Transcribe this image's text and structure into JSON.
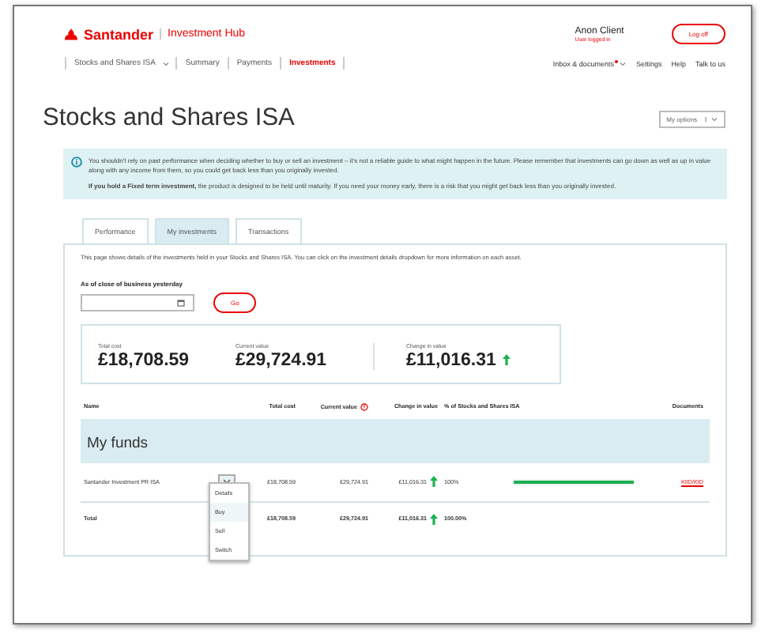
{
  "header": {
    "brand": "Santander",
    "product": "Investment Hub",
    "user": "Anon Client",
    "user_status": "User logged in",
    "logoff": "Log off"
  },
  "nav": {
    "items": [
      {
        "label": "Stocks and Shares ISA",
        "selected": false,
        "dropdown": true
      },
      {
        "label": "Summary",
        "selected": false
      },
      {
        "label": "Payments",
        "selected": false
      },
      {
        "label": "Investments",
        "selected": true
      }
    ],
    "links": [
      {
        "label": "Inbox & documents",
        "alert": true
      },
      {
        "label": "Settings",
        "alert": false
      },
      {
        "label": "Help",
        "alert": false
      },
      {
        "label": "Talk to us",
        "alert": false
      }
    ]
  },
  "title": "Stocks and Shares ISA",
  "options_button": "My options",
  "info": [
    "You shouldn't rely on past performance when deciding whether to buy or sell an investment – it's not a reliable guide to what might happen in the future. Please remember that investments can go down as well as up in value along with any income from them, so you could get back less than you originally invested.",
    "**If you hold a Fixed term investment,** the product is designed to be held until maturity. If you need your money early, there is a risk that you might get back less than you originally invested."
  ],
  "tabs": [
    {
      "label": "Performance",
      "selected": false
    },
    {
      "label": "My investments",
      "selected": true
    },
    {
      "label": "Transactions",
      "selected": false
    }
  ],
  "intro": "This page shows details of the investments held in your Stocks and Shares ISA. You can click on the investment details dropdown for more information on each asset.",
  "date_label": "As of close of business yesterday",
  "go": "Go",
  "summary": [
    {
      "label": "Total cost",
      "value": "£18,708.59",
      "up": false
    },
    {
      "label": "Current value",
      "value": "£29,724.91",
      "up": false
    },
    {
      "label": "Change in value",
      "value": "£11,016.31",
      "up": true
    }
  ],
  "table": {
    "columns": [
      "Name",
      "Total cost",
      "Current value",
      "Change in value",
      "% of Stocks and Shares ISA",
      "Documents"
    ],
    "group": "My funds",
    "rows": [
      {
        "name": "Santander Investment PR ISA",
        "total_cost": "£18,708.59",
        "current_value": "£29,724.91",
        "change": "£11,016.31",
        "up": true,
        "share": "100%",
        "level": 1,
        "document": "KIID/KID"
      }
    ],
    "total": {
      "name": "Total",
      "total_cost": "£18,708.59",
      "current_value": "£29,724.91",
      "change": "£11,016.31",
      "up": true,
      "share": "100.00%"
    }
  },
  "menu": [
    {
      "label": "Details",
      "selected": false
    },
    {
      "label": "Buy",
      "selected": true
    },
    {
      "label": "Sell",
      "selected": false
    },
    {
      "label": "Switch",
      "selected": false
    }
  ]
}
